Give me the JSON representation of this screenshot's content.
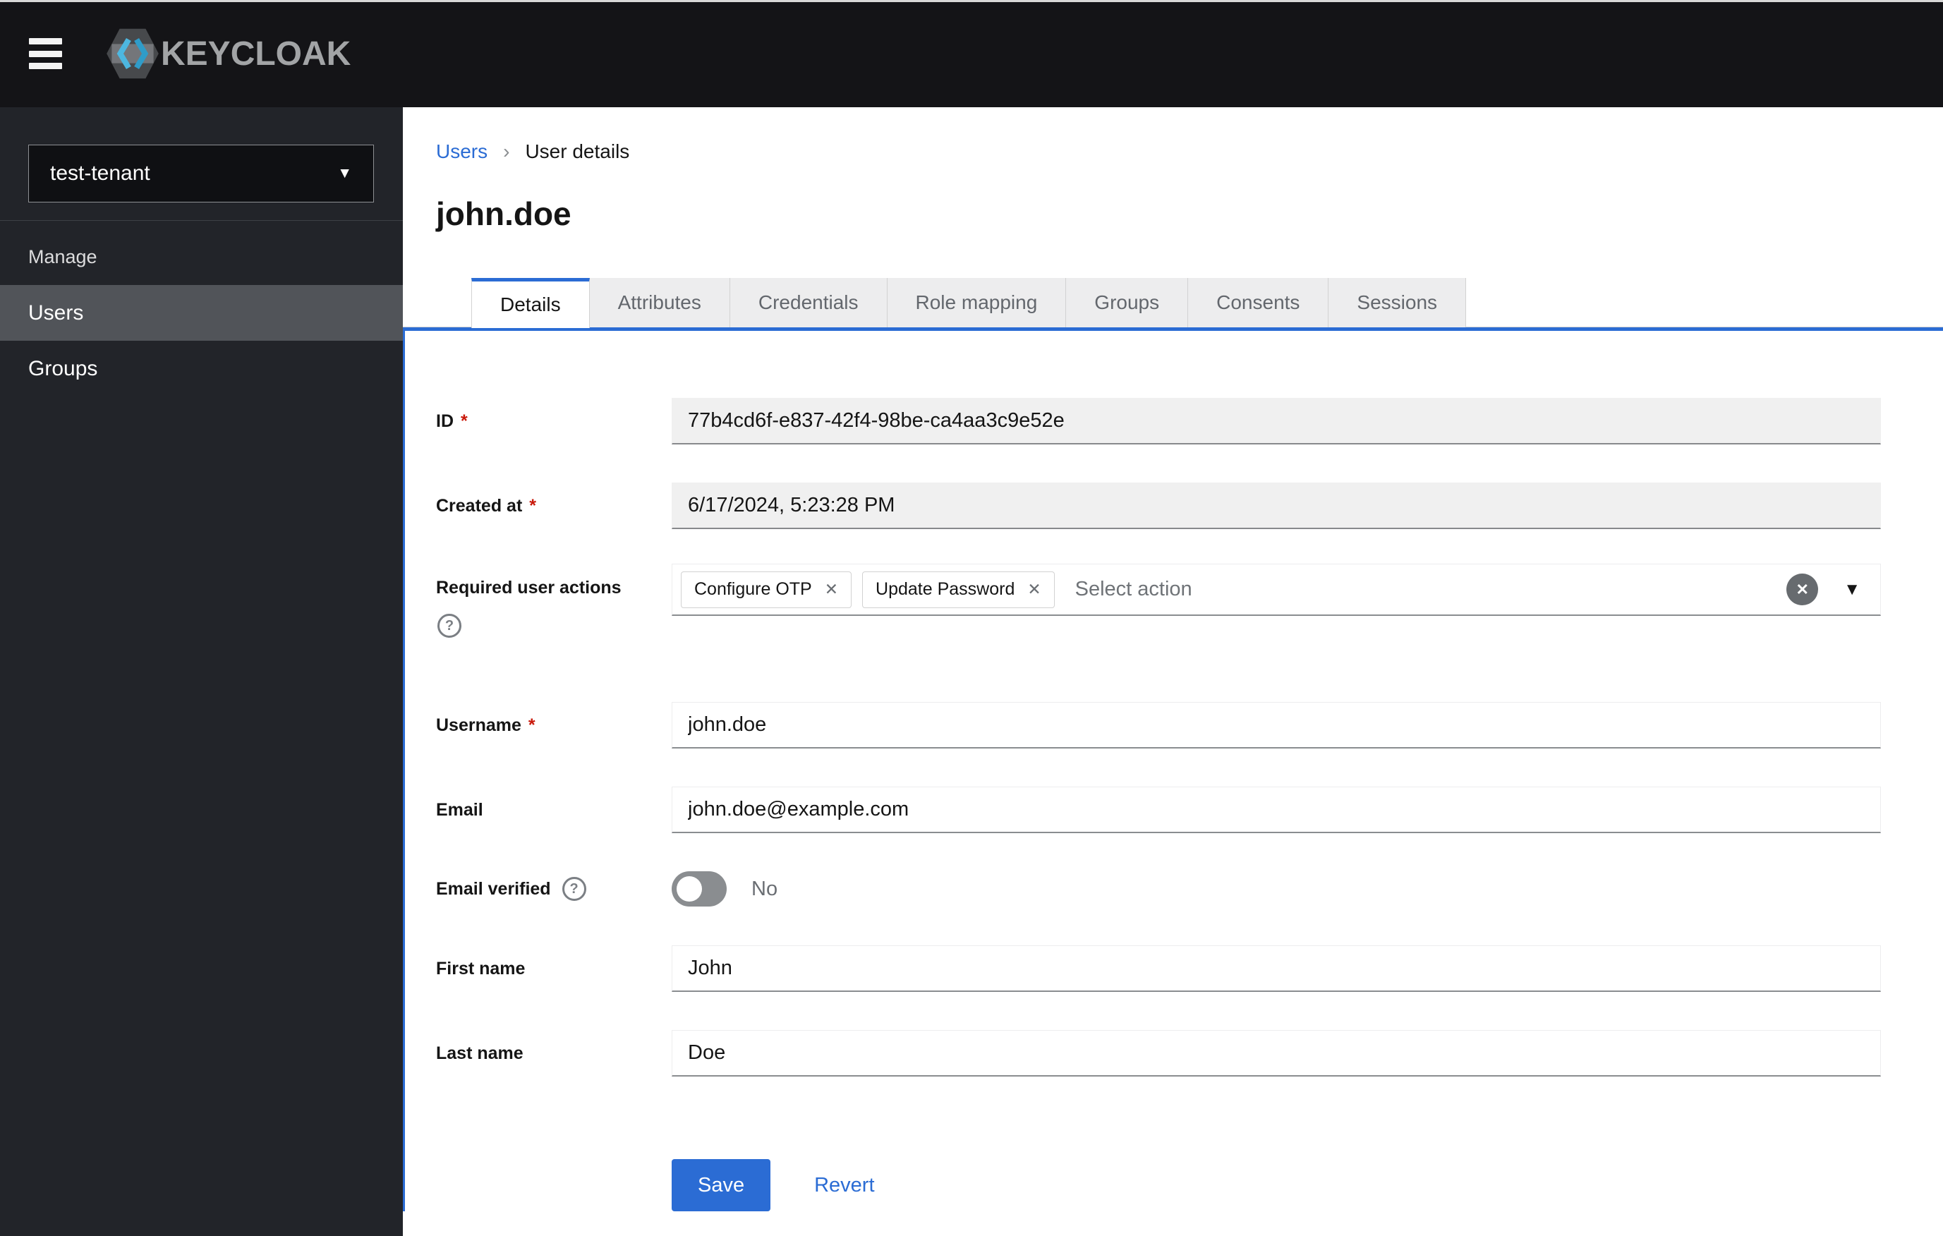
{
  "glyphs": {
    "caret_down": "▼",
    "breadcrumb_sep": "›",
    "chip_close": "✕",
    "clear": "✕",
    "help": "?",
    "required": "*"
  },
  "header": {
    "brand": "KEYCLOAK"
  },
  "sidebar": {
    "realm": "test-tenant",
    "section": "Manage",
    "items": [
      {
        "label": "Users",
        "active": true
      },
      {
        "label": "Groups",
        "active": false
      }
    ]
  },
  "breadcrumb": {
    "root": "Users",
    "current": "User details"
  },
  "page": {
    "title": "john.doe"
  },
  "tabs": {
    "active": "Details",
    "items": [
      "Details",
      "Attributes",
      "Credentials",
      "Role mapping",
      "Groups",
      "Consents",
      "Sessions"
    ]
  },
  "form": {
    "id": {
      "label": "ID",
      "value": "77b4cd6f-e837-42f4-98be-ca4aa3c9e52e",
      "readonly": true
    },
    "created_at": {
      "label": "Created at",
      "value": "6/17/2024, 5:23:28 PM",
      "readonly": true
    },
    "required_actions": {
      "label": "Required user actions",
      "chips": [
        "Configure OTP",
        "Update Password"
      ],
      "placeholder": "Select action"
    },
    "username": {
      "label": "Username",
      "value": "john.doe"
    },
    "email": {
      "label": "Email",
      "value": "john.doe@example.com"
    },
    "email_verified": {
      "label": "Email verified",
      "state_label": "No",
      "enabled": false
    },
    "first_name": {
      "label": "First name",
      "value": "John"
    },
    "last_name": {
      "label": "Last name",
      "value": "Doe"
    },
    "actions": {
      "save": "Save",
      "revert": "Revert"
    }
  },
  "colors": {
    "accent": "#2b6cd4",
    "danger": "#c9190b",
    "masthead": "#141417",
    "sidebar": "#222429",
    "nav_active": "#515459"
  }
}
